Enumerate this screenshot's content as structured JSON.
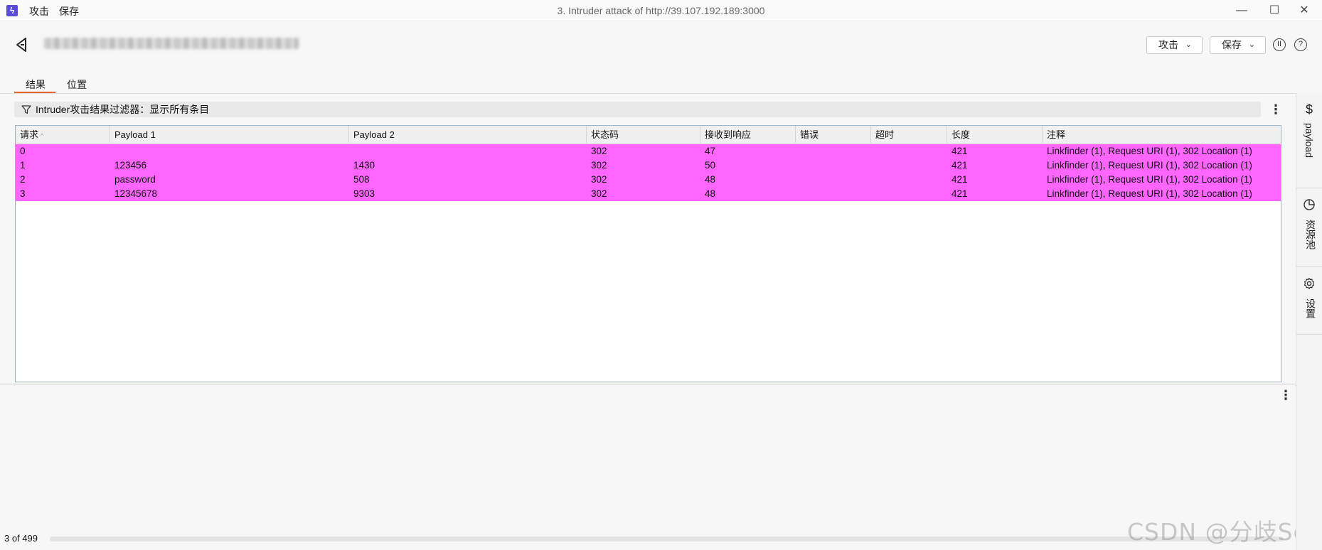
{
  "window": {
    "title": "3. Intruder attack of http://39.107.192.189:3000",
    "menu": [
      "攻击",
      "保存"
    ],
    "controls": {
      "minimize": "—",
      "maximize": "☐",
      "close": "✕"
    }
  },
  "header": {
    "attack_button": "攻击",
    "save_button": "保存",
    "pause_icon": "II",
    "help_icon": "?"
  },
  "tabs": [
    {
      "label": "结果",
      "active": true
    },
    {
      "label": "位置",
      "active": false
    }
  ],
  "filter": {
    "text": "Intruder攻击结果过滤器：显示所有条目"
  },
  "table": {
    "columns": [
      "请求",
      "Payload 1",
      "Payload 2",
      "状态码",
      "接收到响应",
      "错误",
      "超时",
      "长度",
      "注释"
    ],
    "sort_indicator": "^",
    "highlight_color": "#ff66ff",
    "rows": [
      [
        "0",
        "",
        "",
        "302",
        "47",
        "",
        "",
        "421",
        "Linkfinder (1), Request URI (1), 302 Location (1)"
      ],
      [
        "1",
        "123456",
        "1430",
        "302",
        "50",
        "",
        "",
        "421",
        "Linkfinder (1), Request URI (1), 302 Location (1)"
      ],
      [
        "2",
        "password",
        "508",
        "302",
        "48",
        "",
        "",
        "421",
        "Linkfinder (1), Request URI (1), 302 Location (1)"
      ],
      [
        "3",
        "12345678",
        "9303",
        "302",
        "48",
        "",
        "",
        "421",
        "Linkfinder (1), Request URI (1), 302 Location (1)"
      ]
    ]
  },
  "status": {
    "count": "3 of 499"
  },
  "sidebar": {
    "items": [
      {
        "label": "payload",
        "icon": "dollar-icon",
        "glyph": "$"
      },
      {
        "label": "资源池",
        "icon": "pie-chart-icon"
      },
      {
        "label": "设置",
        "icon": "gear-icon"
      }
    ]
  },
  "watermark": "CSDN @分歧Sec"
}
